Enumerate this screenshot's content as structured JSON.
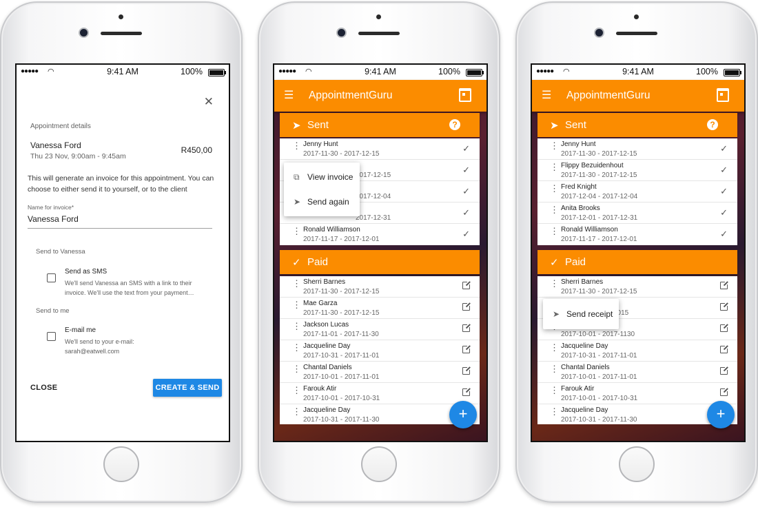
{
  "status": {
    "time": "9:41 AM",
    "battery": "100%"
  },
  "dialog": {
    "section_title": "Appointment details",
    "client_name": "Vanessa Ford",
    "appointment_time": "Thu 23 Nov, 9:00am - 9:45am",
    "price": "R450,00",
    "description": "This will generate an invoice for this appointment. You can choose to either send it to yourself, or to the client",
    "name_field_label": "Name for invoice*",
    "name_field_value": "Vanessa Ford",
    "send_to_client_title": "Send to Vanessa",
    "sms_label": "Send as SMS",
    "sms_desc_1": "We'll send Vanessa an SMS with a link to their",
    "sms_desc_2": "invoice. We'll use the text from your payment…",
    "send_to_me_title": "Send to me",
    "email_label": "E-mail me",
    "email_desc_1": "We'll send to your e-mail:",
    "email_desc_2": "sarah@eatwell.com",
    "close_button": "CLOSE",
    "create_button": "CREATE & SEND"
  },
  "app": {
    "title": "AppointmentGuru"
  },
  "sections": {
    "sent": "Sent",
    "paid": "Paid"
  },
  "help_icon": "?",
  "fab_label": "+",
  "phone2": {
    "sent_rows": [
      {
        "name": "Jenny Hunt",
        "dates": "2017-11-30 - 2017-12-15"
      },
      {
        "name": "",
        "dates": "2017-12-15"
      },
      {
        "name": "",
        "dates": "2017-12-04"
      },
      {
        "name": "",
        "dates": "2017-12-31"
      },
      {
        "name": "Ronald Williamson",
        "dates": "2017-11-17 - 2017-12-01"
      }
    ],
    "popup": {
      "view_invoice": "View invoice",
      "send_again": "Send again"
    },
    "paid_rows": [
      {
        "name": "Sherri Barnes",
        "dates": "2017-11-30 - 2017-12-15"
      },
      {
        "name": "Mae Garza",
        "dates": "2017-11-30 - 2017-12-15"
      },
      {
        "name": "Jackson Lucas",
        "dates": "2017-11-01 - 2017-11-30"
      },
      {
        "name": "Jacqueline Day",
        "dates": "2017-10-31 - 2017-11-01"
      },
      {
        "name": "Chantal Daniels",
        "dates": "2017-10-01 - 2017-11-01"
      },
      {
        "name": "Farouk Atir",
        "dates": "2017-10-01 - 2017-10-31"
      },
      {
        "name": "Jacqueline Day",
        "dates": "2017-10-31 - 2017-11-30"
      }
    ]
  },
  "phone3": {
    "sent_rows": [
      {
        "name": "Jenny Hunt",
        "dates": "2017-11-30 - 2017-12-15"
      },
      {
        "name": "Flippy Bezuidenhout",
        "dates": "2017-11-30 - 2017-12-15"
      },
      {
        "name": "Fred Knight",
        "dates": "2017-12-04 - 2017-12-04"
      },
      {
        "name": "Anita Brooks",
        "dates": "2017-12-01 - 2017-12-31"
      },
      {
        "name": "Ronald Williamson",
        "dates": "2017-11-17 - 2017-12-01"
      }
    ],
    "popup": {
      "send_receipt": "Send receipt"
    },
    "paid_rows": [
      {
        "name": "Sherri Barnes",
        "dates": "2017-11-30 - 2017-12-15"
      },
      {
        "name": "",
        "dates": "1015"
      },
      {
        "name": "",
        "dates": "2017-10-01 - 2017-1130"
      },
      {
        "name": "Jacqueline Day",
        "dates": "2017-10-31 - 2017-11-01"
      },
      {
        "name": "Chantal Daniels",
        "dates": "2017-10-01 - 2017-11-01"
      },
      {
        "name": "Farouk Atir",
        "dates": "2017-10-01 - 2017-10-31"
      },
      {
        "name": "Jacqueline Day",
        "dates": "2017-10-31 - 2017-11-30"
      }
    ]
  }
}
